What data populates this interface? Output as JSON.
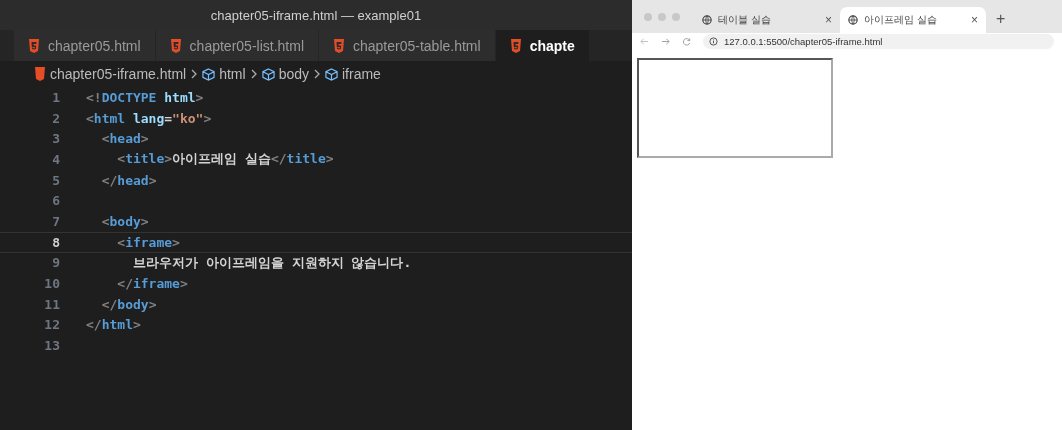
{
  "window": {
    "title": "chapter05-iframe.html — example01"
  },
  "editor_tabs": [
    {
      "label": "chapter05.html",
      "selected": false
    },
    {
      "label": "chapter05-list.html",
      "selected": false
    },
    {
      "label": "chapter05-table.html",
      "selected": false
    },
    {
      "label": "chapte",
      "selected": true
    }
  ],
  "breadcrumb": [
    {
      "kind": "file",
      "label": "chapter05-iframe.html"
    },
    {
      "kind": "element",
      "label": "html"
    },
    {
      "kind": "element",
      "label": "body"
    },
    {
      "kind": "element",
      "label": "iframe"
    }
  ],
  "code_lines": [
    {
      "number": "1",
      "current": false,
      "tokens": [
        {
          "kind": "punct",
          "text": "<!"
        },
        {
          "kind": "tag",
          "text": "DOCTYPE"
        },
        {
          "kind": "attr",
          "text": " html"
        },
        {
          "kind": "punct",
          "text": ">"
        }
      ]
    },
    {
      "number": "2",
      "current": false,
      "tokens": [
        {
          "kind": "punct",
          "text": "<"
        },
        {
          "kind": "tag",
          "text": "html"
        },
        {
          "kind": "attr",
          "text": " lang"
        },
        {
          "kind": "text",
          "text": "="
        },
        {
          "kind": "string",
          "text": "\"ko\""
        },
        {
          "kind": "punct",
          "text": ">"
        }
      ]
    },
    {
      "number": "3",
      "current": false,
      "tokens": [
        {
          "kind": "punct",
          "text": "  <"
        },
        {
          "kind": "tag",
          "text": "head"
        },
        {
          "kind": "punct",
          "text": ">"
        }
      ]
    },
    {
      "number": "4",
      "current": false,
      "tokens": [
        {
          "kind": "punct",
          "text": "    <"
        },
        {
          "kind": "tag",
          "text": "title"
        },
        {
          "kind": "punct",
          "text": ">"
        },
        {
          "kind": "text",
          "text": "아이프레임 실습"
        },
        {
          "kind": "punct",
          "text": "</"
        },
        {
          "kind": "tag",
          "text": "title"
        },
        {
          "kind": "punct",
          "text": ">"
        }
      ]
    },
    {
      "number": "5",
      "current": false,
      "tokens": [
        {
          "kind": "punct",
          "text": "  </"
        },
        {
          "kind": "tag",
          "text": "head"
        },
        {
          "kind": "punct",
          "text": ">"
        }
      ]
    },
    {
      "number": "6",
      "current": false
    },
    {
      "number": "7",
      "current": false,
      "tokens": [
        {
          "kind": "punct",
          "text": "  <"
        },
        {
          "kind": "tag",
          "text": "body"
        },
        {
          "kind": "punct",
          "text": ">"
        }
      ]
    },
    {
      "number": "8",
      "current": true,
      "tokens": [
        {
          "kind": "punct",
          "text": "    <"
        },
        {
          "kind": "tag",
          "text": "iframe"
        },
        {
          "kind": "punct",
          "text": ">"
        }
      ]
    },
    {
      "number": "9",
      "current": false,
      "tokens": [
        {
          "kind": "text",
          "text": "      브라우저가 아이프레임을 지원하지 않습니다."
        }
      ]
    },
    {
      "number": "10",
      "current": false,
      "tokens": [
        {
          "kind": "punct",
          "text": "    </"
        },
        {
          "kind": "tag",
          "text": "iframe"
        },
        {
          "kind": "punct",
          "text": ">"
        }
      ]
    },
    {
      "number": "11",
      "current": false,
      "tokens": [
        {
          "kind": "punct",
          "text": "  </"
        },
        {
          "kind": "tag",
          "text": "body"
        },
        {
          "kind": "punct",
          "text": ">"
        }
      ]
    },
    {
      "number": "12",
      "current": false,
      "tokens": [
        {
          "kind": "punct",
          "text": "</"
        },
        {
          "kind": "tag",
          "text": "html"
        },
        {
          "kind": "punct",
          "text": ">"
        }
      ]
    },
    {
      "number": "13",
      "current": false
    }
  ],
  "browser": {
    "tabs": [
      {
        "label": "테이블 실습",
        "close": "×",
        "selected": false
      },
      {
        "label": "아이프레임 실습",
        "close": "×",
        "selected": true
      }
    ],
    "new_tab": "+",
    "url": "127.0.0.1:5500/chapter05-iframe.html"
  }
}
